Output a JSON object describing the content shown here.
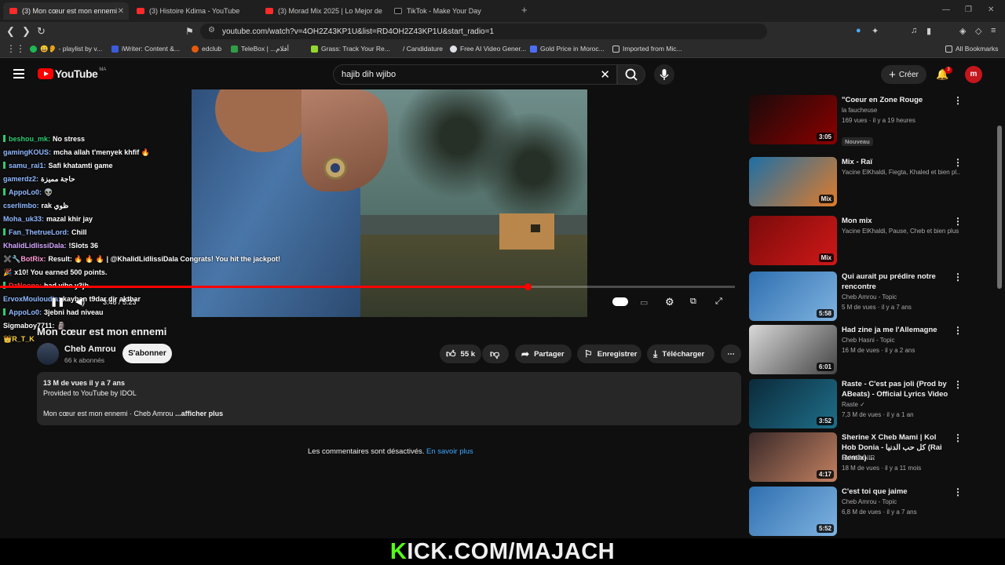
{
  "browser": {
    "tabs": [
      {
        "label": "(3) Mon cœur est mon ennemi",
        "active": true
      },
      {
        "label": "(3) Histoire Kdima - YouTube",
        "active": false
      },
      {
        "label": "(3) Morad Mix 2025 | Lo Mejor de Mor",
        "active": false
      },
      {
        "label": "TikTok - Make Your Day",
        "active": false
      }
    ],
    "new_tab": "+",
    "url": "youtube.com/watch?v=4OH2Z43KP1U&list=RD4OH2Z43KP1U&start_radio=1",
    "bookmarks": [
      {
        "label": "😀👂 - playlist by v...",
        "color": "#1db954"
      },
      {
        "label": "iWriter: Content &...",
        "color": "#3b5bdb"
      },
      {
        "label": "edclub",
        "color": "#e8590c"
      },
      {
        "label": "TeleBox | ...أفلام",
        "color": "#2f9e44"
      },
      {
        "label": "Grass: Track Your Re...",
        "color": "#94d82d"
      },
      {
        "label": "/ Candidature",
        "color": "#2b2b2b"
      },
      {
        "label": "Free AI Video Gener...",
        "color": "#dee2e6"
      },
      {
        "label": "Gold Price in Moroc...",
        "color": "#4c6ef5"
      },
      {
        "label": "Imported from Mic...",
        "color": "#2b2b2b"
      }
    ],
    "all_bookmarks": "All Bookmarks"
  },
  "header": {
    "logo_text": "YouTube",
    "region": "MA",
    "search_value": "hajib dih wjibo",
    "create_label": "Créer",
    "notif_count": "3",
    "avatar_letter": "m"
  },
  "player": {
    "time": "3:46 / 5:23",
    "progress": 0.718
  },
  "chat": [
    {
      "user": "beshou_mk:",
      "msg": "No stress",
      "color": "#2ecc71",
      "badge": true
    },
    {
      "user": "gamingKOUS:",
      "msg": "mcha allah t'menyek khfif 🔥",
      "color": "#8fb8ff",
      "badge": false
    },
    {
      "user": "samu_rai1:",
      "msg": "Safi khatamti game",
      "color": "#8fb8ff",
      "badge": true
    },
    {
      "user": "gamerdz2:",
      "msg": "حاجة مميزة",
      "color": "#8fb8ff",
      "badge": false
    },
    {
      "user": "AppoLo0:",
      "msg": "👽",
      "color": "#8fb8ff",
      "badge": true
    },
    {
      "user": "cserlimbo:",
      "msg": "rak ظوي",
      "color": "#8fb8ff",
      "badge": false
    },
    {
      "user": "Moha_uk33:",
      "msg": "mazal khir jay",
      "color": "#8fb8ff",
      "badge": false
    },
    {
      "user": "Fan_ThetrueLord:",
      "msg": "Chill",
      "color": "#8fb8ff",
      "badge": true
    },
    {
      "user": "KhalidLidlissiDala:",
      "msg": "!Slots 36",
      "color": "#d4a5ff",
      "badge": false
    },
    {
      "user": "✖️🔧BotRix:",
      "msg": "Result: 🔥 🔥 🔥 | @KhalidLidlissiDala Congrats! You hit the jackpot!",
      "color": "#ff9ad5",
      "badge": false
    },
    {
      "user": "🎉",
      "msg": "x10! You earned 500 points.",
      "color": "#ffffff",
      "badge": false
    },
    {
      "user": "DzNoone:",
      "msg": "had vibe y3jb",
      "color": "#ff3b3b",
      "badge": true
    },
    {
      "user": "ErvoxMouloudia:",
      "msg": "kayban t9dar dir akthar",
      "color": "#8fb8ff",
      "badge": false
    },
    {
      "user": "AppoLo0:",
      "msg": "3jebni had niveau",
      "color": "#8fb8ff",
      "badge": true
    },
    {
      "user": "Sigmaboy7711:",
      "msg": "🗿",
      "color": "#ffffff",
      "badge": false
    },
    {
      "user": "👑R_T_K",
      "msg": "",
      "color": "#ffd43b",
      "badge": false
    }
  ],
  "video": {
    "title": "Mon cœur est mon ennemi",
    "channel": "Cheb Amrou",
    "subscribers": "66 k abonnés",
    "subscribe_label": "S'abonner",
    "likes": "55 k",
    "share": "Partager",
    "save": "Enregistrer",
    "download": "Télécharger",
    "more": "⋯"
  },
  "description": {
    "stats": "13 M de vues  il y a 7 ans",
    "line1": "Provided to YouTube by IDOL",
    "line2": "Mon cœur est mon ennemi · Cheb Amrou",
    "more": "...afficher plus"
  },
  "comments": {
    "disabled": "Les commentaires sont désactivés.",
    "learn_more": "En savoir plus"
  },
  "sidebar": [
    {
      "title": "\"Coeur en Zone Rouge",
      "meta1": "la faucheuse",
      "meta2": "169 vues · il y a 19 heures",
      "badge": "Nouveau",
      "dur": "3:05",
      "thumb": [
        "#1a0a0a",
        "#8b0000"
      ]
    },
    {
      "title": "Mix - Raï",
      "meta1": "Yacine ElKhaldi, Fiegta, Khaled et bien pl...",
      "meta2": "",
      "badge": "",
      "dur": "Mix",
      "thumb": [
        "#1d6fa5",
        "#e07b2a"
      ]
    },
    {
      "title": "Mon mix",
      "meta1": "Yacine ElKhaldi, Pause, Cheb et bien plus...",
      "meta2": "",
      "badge": "",
      "dur": "Mix",
      "thumb": [
        "#7a0b0b",
        "#d01818"
      ]
    },
    {
      "title": "Qui aurait pu prédire notre rencontre",
      "meta1": "Cheb Amrou - Topic",
      "meta2": "5 M de vues · il y a 7 ans",
      "badge": "",
      "dur": "5:58",
      "thumb": [
        "#2f6fb0",
        "#7fb3e0"
      ]
    },
    {
      "title": "Had zine ja me l'Allemagne",
      "meta1": "Cheb Hasni - Topic",
      "meta2": "16 M de vues · il y a 2 ans",
      "badge": "",
      "dur": "6:01",
      "thumb": [
        "#d9d9d9",
        "#444444"
      ]
    },
    {
      "title": "Raste - C'est pas joli (Prod by ABeats) - Official Lyrics Video",
      "meta1": "Raste ✓",
      "meta2": "7,3 M de vues · il y a 1 an",
      "badge": "",
      "dur": "3:52",
      "thumb": [
        "#0b2a3a",
        "#1f6f8a"
      ]
    },
    {
      "title": "Sherine X Cheb Mami | Kol Hob Donia - كل حب الدنيا (Rai Remix) ...",
      "meta1": "ELMOUNIR",
      "meta2": "18 M de vues · il y a 11 mois",
      "badge": "",
      "dur": "4:17",
      "thumb": [
        "#3a2a2a",
        "#c28060"
      ]
    },
    {
      "title": "C'est toi que jaime",
      "meta1": "Cheb Amrou - Topic",
      "meta2": "6,8 M de vues · il y a 7 ans",
      "badge": "",
      "dur": "5:52",
      "thumb": [
        "#2f6fb0",
        "#7fb3e0"
      ]
    }
  ],
  "watermark": {
    "k": "K",
    "rest": "ICK.COM/MAJACH"
  }
}
